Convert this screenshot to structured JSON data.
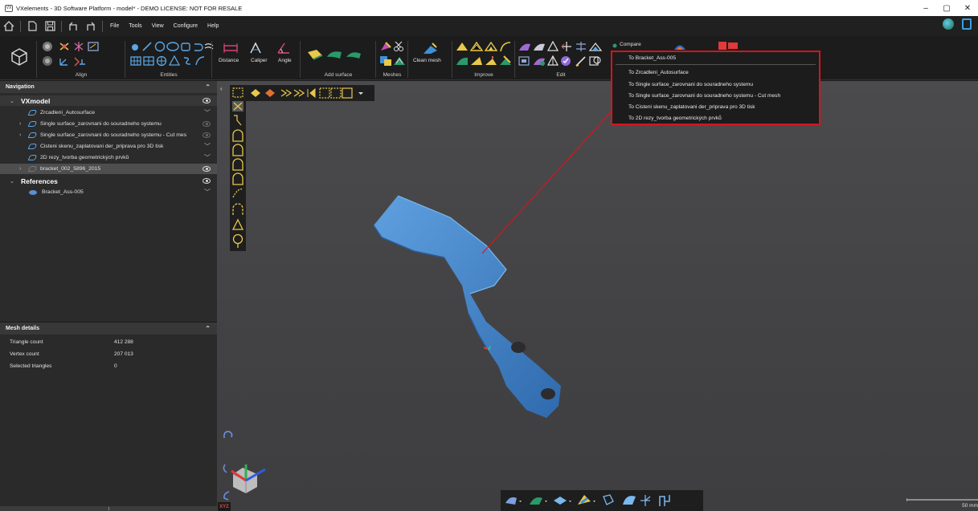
{
  "window": {
    "app_icon": "VX",
    "title": "VXelements - 3D Software Platform - model* - DEMO LICENSE: NOT FOR RESALE",
    "controls": {
      "minimize": "–",
      "maximize": "▢",
      "close": "✕"
    }
  },
  "menubar": {
    "items": [
      "File",
      "Tools",
      "View",
      "Configure",
      "Help"
    ],
    "quick_access_icons": [
      "home-icon",
      "new-icon",
      "save-icon",
      "undo-icon",
      "redo-icon"
    ]
  },
  "ribbon": {
    "groups": {
      "align": "Align",
      "entities": "Entities",
      "add_surface": "Add surface",
      "meshes": "Meshes",
      "improve": "Improve",
      "edit": "Edit"
    },
    "tools": {
      "distance": "Distance",
      "caliper": "Caliper",
      "angle": "Angle",
      "clean_mesh": "Clean mesh",
      "compare": "Compare"
    }
  },
  "compare_menu": {
    "items": [
      "To Bracket_Ass-005",
      "To Zrcadleni_Autosurface",
      "To Single surface_zarovnani do souradneho systemu",
      "To Single surface_zarovnani do souradneho systemu - Cut mesh",
      "To Cisteni skenu_zaplatovani der_priprava pro 3D tisk",
      "To 2D rezy_tvorba geometrických prvků"
    ],
    "highlight_color": "#d5151e"
  },
  "navigation": {
    "header": "Navigation",
    "vxmodel_label": "VXmodel",
    "items": [
      "Zrcadleni_Autosurface",
      "Single surface_zarovnani do souradneho systemu",
      "Single surface_zarovnani do souradneho systemu - Cut mes",
      "Cisteni skenu_zaplatovani der_priprava pro 3D tisk",
      "2D rezy_tvorba geometrických prvků",
      "bracket_002_5896_2015"
    ],
    "references_label": "References",
    "references": [
      "Bracket_Ass-005"
    ]
  },
  "mesh_details": {
    "header": "Mesh details",
    "rows": [
      {
        "label": "Triangle count",
        "value": "412 288"
      },
      {
        "label": "Vertex count",
        "value": "207 013"
      },
      {
        "label": "Selected triangles",
        "value": "0"
      }
    ]
  },
  "viewport": {
    "axis_badge": "XYZ",
    "scale_label": "50 mm",
    "part_color": "#3f7fc4"
  }
}
